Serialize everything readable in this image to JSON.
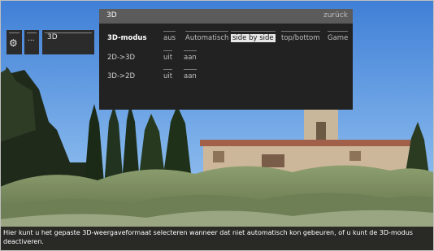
{
  "tiles": {
    "gear_icon": "settings",
    "more_label": "...",
    "label_3d": "3D"
  },
  "panel": {
    "title": "3D",
    "back_label": "zurück",
    "rows": [
      {
        "label": "3D-modus",
        "options": [
          "aus",
          "Automatisch",
          "side by side",
          "top/bottom",
          "Game"
        ],
        "selected": "side by side"
      },
      {
        "label": "2D->3D",
        "options": [
          "uit",
          "aan"
        ]
      },
      {
        "label": "3D->2D",
        "options": [
          "uit",
          "aan"
        ]
      }
    ]
  },
  "caption": "Hier kunt u het gepaste 3D-weergaveformaat selecteren wanneer dat niet automatisch kon gebeuren, of u kunt de 3D-modus deactiveren."
}
